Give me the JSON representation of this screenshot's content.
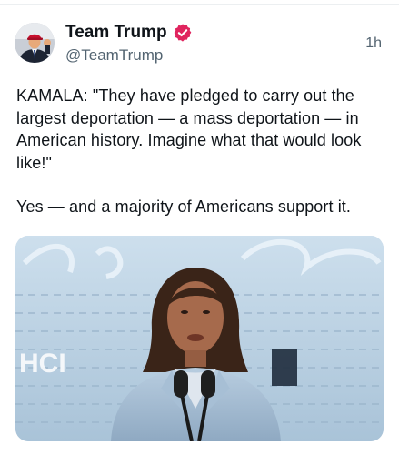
{
  "post": {
    "author": {
      "display_name": "Team Trump",
      "handle": "@TeamTrump",
      "verified_icon": "verified-badge-icon",
      "verified_color": "#e0245e",
      "avatar_icon": "profile-avatar"
    },
    "timestamp": "1h",
    "body_paragraphs": [
      "KAMALA: \"They have pledged to carry out the largest deportation — a mass deportation — in American history. Imagine what that would look like!\"",
      "Yes — and a majority of Americans support it."
    ],
    "media": {
      "type": "image",
      "icon": "photo-of-speaker-at-podium",
      "backdrop_fragment": "HCI"
    }
  }
}
